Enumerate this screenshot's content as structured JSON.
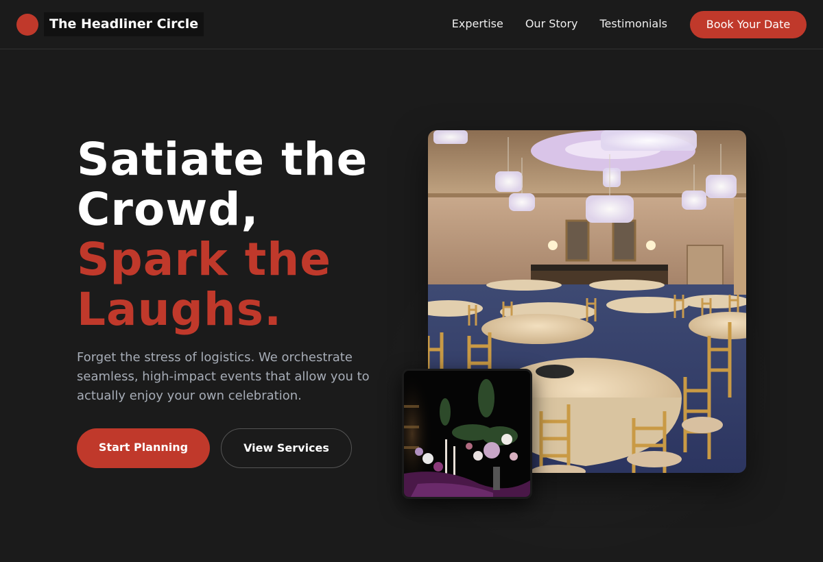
{
  "header": {
    "brand": "The Headliner Circle",
    "nav": [
      {
        "label": "Expertise"
      },
      {
        "label": "Our Story"
      },
      {
        "label": "Testimonials"
      }
    ],
    "cta_label": "Book Your Date"
  },
  "hero": {
    "title_line1": "Satiate the",
    "title_line2": "Crowd,",
    "title_accent_line1": "Spark the",
    "title_accent_line2": "Laughs.",
    "subtitle": "Forget the stress of logistics. We orchestrate seamless, high-impact events that allow you to actually enjoy your own celebration.",
    "primary_button": "Start Planning",
    "secondary_button": "View Services"
  },
  "images": {
    "main_photo": "ballroom-banquet-photo",
    "inset_photo": "floral-centerpiece-photo"
  },
  "colors": {
    "background": "#1b1b1b",
    "accent": "#c0392b",
    "muted_text": "#a7adb7"
  }
}
